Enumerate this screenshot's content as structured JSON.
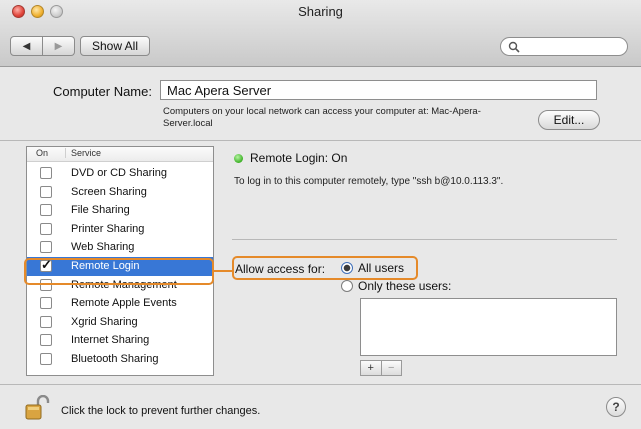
{
  "window": {
    "title": "Sharing"
  },
  "toolbar": {
    "back_icon": "chevron-left",
    "forward_icon": "chevron-right",
    "show_all_label": "Show All",
    "search_placeholder": ""
  },
  "computer_name": {
    "label": "Computer Name:",
    "value": "Mac Apera Server",
    "note": "Computers on your local network can access your computer at: Mac-Apera-Server.local",
    "edit_label": "Edit..."
  },
  "services": {
    "header_on": "On",
    "header_service": "Service",
    "items": [
      {
        "label": "DVD or CD Sharing",
        "on": false,
        "selected": false
      },
      {
        "label": "Screen Sharing",
        "on": false,
        "selected": false
      },
      {
        "label": "File Sharing",
        "on": false,
        "selected": false
      },
      {
        "label": "Printer Sharing",
        "on": false,
        "selected": false
      },
      {
        "label": "Web Sharing",
        "on": false,
        "selected": false
      },
      {
        "label": "Remote Login",
        "on": true,
        "selected": true
      },
      {
        "label": "Remote Management",
        "on": false,
        "selected": false
      },
      {
        "label": "Remote Apple Events",
        "on": false,
        "selected": false
      },
      {
        "label": "Xgrid Sharing",
        "on": false,
        "selected": false
      },
      {
        "label": "Internet Sharing",
        "on": false,
        "selected": false
      },
      {
        "label": "Bluetooth Sharing",
        "on": false,
        "selected": false
      }
    ]
  },
  "detail": {
    "status": "Remote Login: On",
    "status_color": "#3cb026",
    "hint": "To log in to this computer remotely, type \"ssh b@10.0.113.3\".",
    "allow_label": "Allow access for:",
    "option_all": "All users",
    "option_only": "Only these users:",
    "selected_option": "All users",
    "add_label": "+",
    "remove_label": "−"
  },
  "footer": {
    "lock_text": "Click the lock to prevent further changes.",
    "help_label": "?"
  },
  "colors": {
    "selection": "#3877d6",
    "highlight": "#e58a2a"
  }
}
